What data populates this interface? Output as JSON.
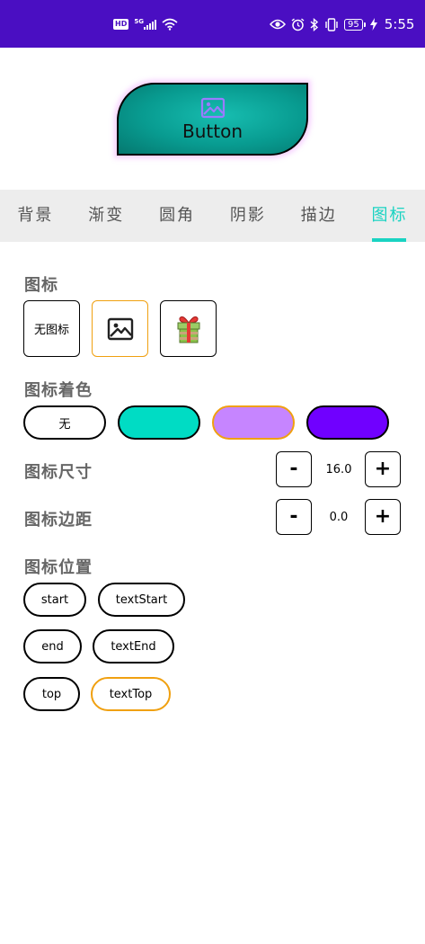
{
  "status_bar": {
    "hd": "HD",
    "network": "5G",
    "battery": "95",
    "time": "5:55",
    "icons": [
      "hd-icon",
      "signal-icon",
      "wifi-icon",
      "eye-icon",
      "alarm-icon",
      "bluetooth-icon",
      "vibrate-icon",
      "battery-icon",
      "charging-icon"
    ]
  },
  "preview": {
    "button_label": "Button",
    "icon": "image-icon",
    "colors": {
      "fill": "#089b90",
      "border": "#000000",
      "icon_tint": "#9b7bff"
    }
  },
  "tabs": [
    {
      "label": "背景"
    },
    {
      "label": "渐变"
    },
    {
      "label": "圆角"
    },
    {
      "label": "阴影"
    },
    {
      "label": "描边"
    },
    {
      "label": "图标",
      "active": true
    }
  ],
  "icon_section": {
    "title": "图标",
    "options": [
      {
        "label": "无图标"
      },
      {
        "icon": "image-icon",
        "selected": true
      },
      {
        "icon": "gift-icon"
      }
    ]
  },
  "tint_section": {
    "title": "图标着色",
    "options": [
      {
        "label": "无",
        "color": "#ffffff"
      },
      {
        "label": "",
        "color": "#00dcc4"
      },
      {
        "label": "",
        "color": "#c685ff",
        "selected": true
      },
      {
        "label": "",
        "color": "#7000ff"
      }
    ]
  },
  "size_section": {
    "title": "图标尺寸",
    "minus": "-",
    "value": "16.0",
    "plus": "+"
  },
  "padding_section": {
    "title": "图标边距",
    "minus": "-",
    "value": "0.0",
    "plus": "+"
  },
  "gravity_section": {
    "title": "图标位置",
    "options": [
      {
        "label": "start"
      },
      {
        "label": "textStart"
      },
      {
        "label": "end"
      },
      {
        "label": "textEnd"
      },
      {
        "label": "top"
      },
      {
        "label": "textTop",
        "selected": true
      }
    ]
  },
  "colors": {
    "status_bar": "#4a0ec2",
    "accent": "#1ad3c2",
    "selected_border": "#f0a010",
    "tab_bar_bg": "#ededed"
  }
}
